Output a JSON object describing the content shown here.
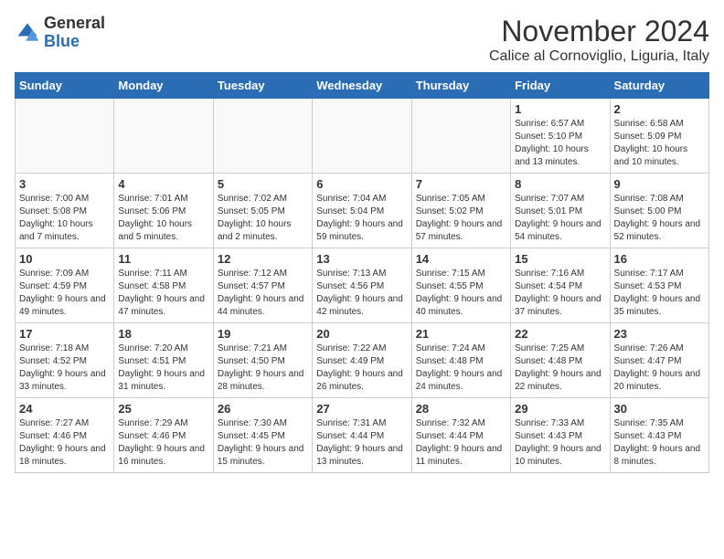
{
  "logo": {
    "general": "General",
    "blue": "Blue"
  },
  "title": "November 2024",
  "subtitle": "Calice al Cornoviglio, Liguria, Italy",
  "days_of_week": [
    "Sunday",
    "Monday",
    "Tuesday",
    "Wednesday",
    "Thursday",
    "Friday",
    "Saturday"
  ],
  "weeks": [
    [
      {
        "day": "",
        "info": ""
      },
      {
        "day": "",
        "info": ""
      },
      {
        "day": "",
        "info": ""
      },
      {
        "day": "",
        "info": ""
      },
      {
        "day": "",
        "info": ""
      },
      {
        "day": "1",
        "info": "Sunrise: 6:57 AM\nSunset: 5:10 PM\nDaylight: 10 hours and 13 minutes."
      },
      {
        "day": "2",
        "info": "Sunrise: 6:58 AM\nSunset: 5:09 PM\nDaylight: 10 hours and 10 minutes."
      }
    ],
    [
      {
        "day": "3",
        "info": "Sunrise: 7:00 AM\nSunset: 5:08 PM\nDaylight: 10 hours and 7 minutes."
      },
      {
        "day": "4",
        "info": "Sunrise: 7:01 AM\nSunset: 5:06 PM\nDaylight: 10 hours and 5 minutes."
      },
      {
        "day": "5",
        "info": "Sunrise: 7:02 AM\nSunset: 5:05 PM\nDaylight: 10 hours and 2 minutes."
      },
      {
        "day": "6",
        "info": "Sunrise: 7:04 AM\nSunset: 5:04 PM\nDaylight: 9 hours and 59 minutes."
      },
      {
        "day": "7",
        "info": "Sunrise: 7:05 AM\nSunset: 5:02 PM\nDaylight: 9 hours and 57 minutes."
      },
      {
        "day": "8",
        "info": "Sunrise: 7:07 AM\nSunset: 5:01 PM\nDaylight: 9 hours and 54 minutes."
      },
      {
        "day": "9",
        "info": "Sunrise: 7:08 AM\nSunset: 5:00 PM\nDaylight: 9 hours and 52 minutes."
      }
    ],
    [
      {
        "day": "10",
        "info": "Sunrise: 7:09 AM\nSunset: 4:59 PM\nDaylight: 9 hours and 49 minutes."
      },
      {
        "day": "11",
        "info": "Sunrise: 7:11 AM\nSunset: 4:58 PM\nDaylight: 9 hours and 47 minutes."
      },
      {
        "day": "12",
        "info": "Sunrise: 7:12 AM\nSunset: 4:57 PM\nDaylight: 9 hours and 44 minutes."
      },
      {
        "day": "13",
        "info": "Sunrise: 7:13 AM\nSunset: 4:56 PM\nDaylight: 9 hours and 42 minutes."
      },
      {
        "day": "14",
        "info": "Sunrise: 7:15 AM\nSunset: 4:55 PM\nDaylight: 9 hours and 40 minutes."
      },
      {
        "day": "15",
        "info": "Sunrise: 7:16 AM\nSunset: 4:54 PM\nDaylight: 9 hours and 37 minutes."
      },
      {
        "day": "16",
        "info": "Sunrise: 7:17 AM\nSunset: 4:53 PM\nDaylight: 9 hours and 35 minutes."
      }
    ],
    [
      {
        "day": "17",
        "info": "Sunrise: 7:18 AM\nSunset: 4:52 PM\nDaylight: 9 hours and 33 minutes."
      },
      {
        "day": "18",
        "info": "Sunrise: 7:20 AM\nSunset: 4:51 PM\nDaylight: 9 hours and 31 minutes."
      },
      {
        "day": "19",
        "info": "Sunrise: 7:21 AM\nSunset: 4:50 PM\nDaylight: 9 hours and 28 minutes."
      },
      {
        "day": "20",
        "info": "Sunrise: 7:22 AM\nSunset: 4:49 PM\nDaylight: 9 hours and 26 minutes."
      },
      {
        "day": "21",
        "info": "Sunrise: 7:24 AM\nSunset: 4:48 PM\nDaylight: 9 hours and 24 minutes."
      },
      {
        "day": "22",
        "info": "Sunrise: 7:25 AM\nSunset: 4:48 PM\nDaylight: 9 hours and 22 minutes."
      },
      {
        "day": "23",
        "info": "Sunrise: 7:26 AM\nSunset: 4:47 PM\nDaylight: 9 hours and 20 minutes."
      }
    ],
    [
      {
        "day": "24",
        "info": "Sunrise: 7:27 AM\nSunset: 4:46 PM\nDaylight: 9 hours and 18 minutes."
      },
      {
        "day": "25",
        "info": "Sunrise: 7:29 AM\nSunset: 4:46 PM\nDaylight: 9 hours and 16 minutes."
      },
      {
        "day": "26",
        "info": "Sunrise: 7:30 AM\nSunset: 4:45 PM\nDaylight: 9 hours and 15 minutes."
      },
      {
        "day": "27",
        "info": "Sunrise: 7:31 AM\nSunset: 4:44 PM\nDaylight: 9 hours and 13 minutes."
      },
      {
        "day": "28",
        "info": "Sunrise: 7:32 AM\nSunset: 4:44 PM\nDaylight: 9 hours and 11 minutes."
      },
      {
        "day": "29",
        "info": "Sunrise: 7:33 AM\nSunset: 4:43 PM\nDaylight: 9 hours and 10 minutes."
      },
      {
        "day": "30",
        "info": "Sunrise: 7:35 AM\nSunset: 4:43 PM\nDaylight: 9 hours and 8 minutes."
      }
    ]
  ]
}
